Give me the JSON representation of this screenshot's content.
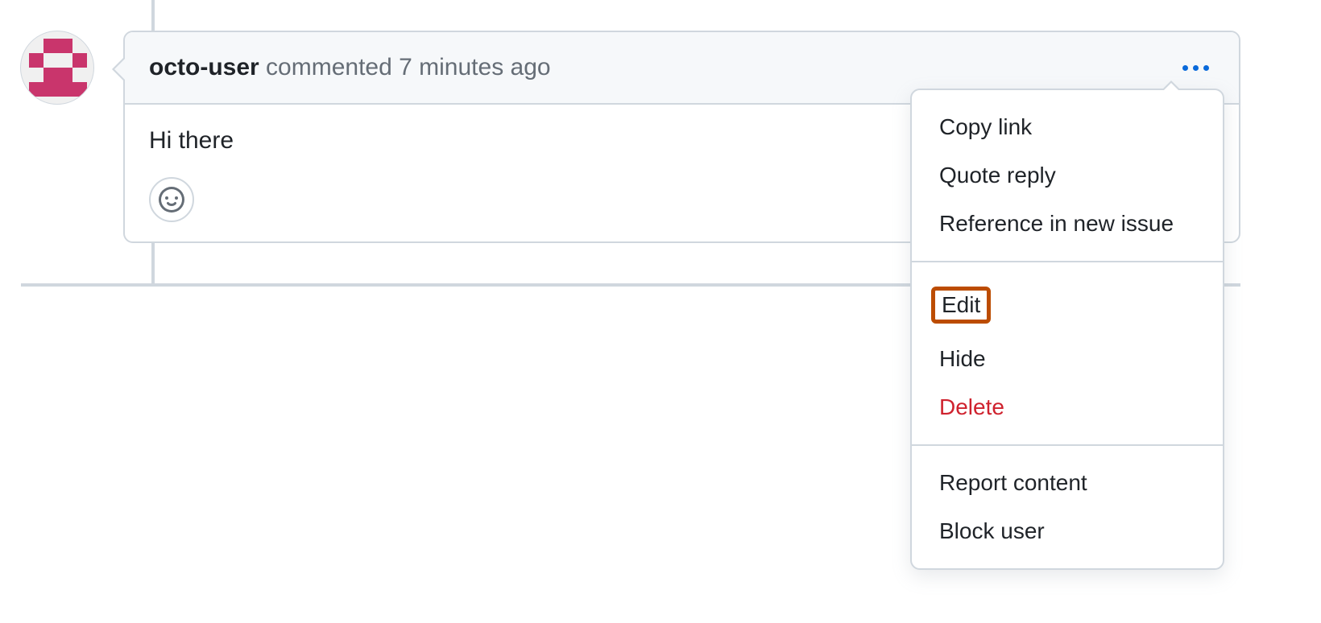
{
  "comment": {
    "username": "octo-user",
    "action": "commented",
    "timestamp": "7 minutes ago",
    "body": "Hi there"
  },
  "dropdown": {
    "copy_link": "Copy link",
    "quote_reply": "Quote reply",
    "reference_new_issue": "Reference in new issue",
    "edit": "Edit",
    "hide": "Hide",
    "delete": "Delete",
    "report_content": "Report content",
    "block_user": "Block user"
  }
}
